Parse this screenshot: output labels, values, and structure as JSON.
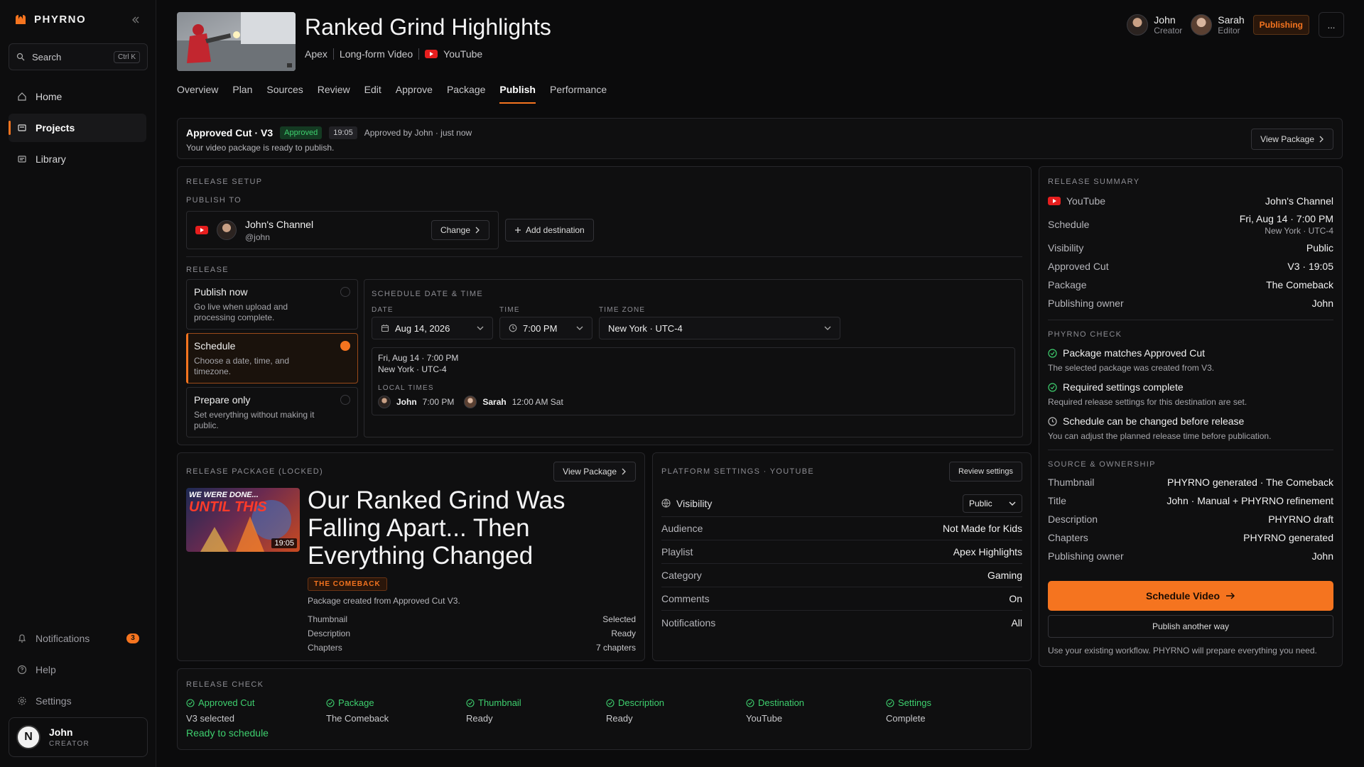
{
  "app": {
    "brand": "PHYRNO",
    "search_placeholder": "Search",
    "search_shortcut": "Ctrl K",
    "nav": [
      {
        "label": "Home",
        "icon": "home-icon"
      },
      {
        "label": "Projects",
        "icon": "folder-icon",
        "active": true
      },
      {
        "label": "Library",
        "icon": "library-icon"
      }
    ],
    "nav_bottom": {
      "notifications": "Notifications",
      "notifications_count": "3",
      "help": "Help",
      "settings": "Settings"
    },
    "user": {
      "initial": "N",
      "name": "John",
      "role": "CREATOR"
    }
  },
  "header": {
    "title": "Ranked Grind Highlights",
    "game": "Apex",
    "format": "Long-form Video",
    "platform": "YouTube",
    "collaborators": [
      {
        "name": "John",
        "role": "Creator"
      },
      {
        "name": "Sarah",
        "role": "Editor"
      }
    ],
    "status": "Publishing",
    "more": "..."
  },
  "tabs": [
    "Overview",
    "Plan",
    "Sources",
    "Review",
    "Edit",
    "Approve",
    "Package",
    "Publish",
    "Performance"
  ],
  "active_tab": "Publish",
  "approved_banner": {
    "title": "Approved Cut · V3",
    "badge": "Approved",
    "duration": "19:05",
    "approved_by": "Approved by John · just now",
    "subtitle": "Your video package is ready to publish.",
    "view_package": "View Package"
  },
  "release_setup": {
    "heading": "RELEASE SETUP",
    "publish_to": "PUBLISH TO",
    "channel_name": "John's Channel",
    "channel_handle": "@john",
    "change": "Change",
    "add_destination": "Add destination",
    "release_label": "RELEASE",
    "options": [
      {
        "title": "Publish now",
        "desc": "Go live when upload and processing complete."
      },
      {
        "title": "Schedule",
        "desc": "Choose a date, time, and timezone.",
        "selected": true
      },
      {
        "title": "Prepare only",
        "desc": "Set everything without making it public."
      }
    ],
    "schedule": {
      "heading": "SCHEDULE DATE & TIME",
      "date_label": "DATE",
      "date": "Aug 14, 2026",
      "time_label": "TIME",
      "time": "7:00 PM",
      "tz_label": "TIME ZONE",
      "tz": "New York · UTC-4",
      "summary_line1": "Fri, Aug 14 · 7:00 PM",
      "summary_line2": "New York · UTC-4",
      "local_times_label": "LOCAL TIMES",
      "local_times": [
        {
          "name": "John",
          "time": "7:00 PM"
        },
        {
          "name": "Sarah",
          "time": "12:00 AM Sat"
        }
      ]
    }
  },
  "release_summary": {
    "heading": "RELEASE SUMMARY",
    "platform": "YouTube",
    "channel": "John's Channel",
    "rows": [
      {
        "k": "Schedule",
        "v": "Fri, Aug 14 · 7:00 PM",
        "sub": "New York · UTC-4"
      },
      {
        "k": "Visibility",
        "v": "Public"
      },
      {
        "k": "Approved Cut",
        "v": "V3 · 19:05"
      },
      {
        "k": "Package",
        "v": "The Comeback"
      },
      {
        "k": "Publishing owner",
        "v": "John"
      }
    ],
    "check_heading": "PHYRNO CHECK",
    "checks": [
      {
        "title": "Package matches Approved Cut",
        "desc": "The selected package was created from V3."
      },
      {
        "title": "Required settings complete",
        "desc": "Required release settings for this destination are set."
      },
      {
        "title": "Schedule can be changed before release",
        "desc": "You can adjust the planned release time before publication."
      }
    ],
    "source_heading": "SOURCE & OWNERSHIP",
    "source_rows": [
      {
        "k": "Thumbnail",
        "v": "PHYRNO generated · The Comeback"
      },
      {
        "k": "Title",
        "v": "John · Manual + PHYRNO refinement"
      },
      {
        "k": "Description",
        "v": "PHYRNO draft"
      },
      {
        "k": "Chapters",
        "v": "PHYRNO generated"
      },
      {
        "k": "Publishing owner",
        "v": "John"
      }
    ],
    "primary_cta": "Schedule Video",
    "secondary_cta": "Publish another way",
    "footnote": "Use your existing workflow. PHYRNO will prepare everything you need."
  },
  "release_package": {
    "heading": "RELEASE PACKAGE (LOCKED)",
    "view_package": "View Package",
    "thumb_text_1": "WE WERE DONE...",
    "thumb_text_2": "UNTIL THIS",
    "thumb_duration": "19:05",
    "title": "Our Ranked Grind Was Falling Apart... Then Everything Changed",
    "tag": "THE COMEBACK",
    "created_from": "Package created from Approved Cut V3.",
    "rows": [
      {
        "k": "Thumbnail",
        "v": "Selected"
      },
      {
        "k": "Description",
        "v": "Ready"
      },
      {
        "k": "Chapters",
        "v": "7 chapters"
      }
    ]
  },
  "platform_settings": {
    "heading": "PLATFORM SETTINGS · YOUTUBE",
    "review": "Review settings",
    "visibility_label": "Visibility",
    "visibility_value": "Public",
    "rows": [
      {
        "k": "Audience",
        "v": "Not Made for Kids"
      },
      {
        "k": "Playlist",
        "v": "Apex Highlights"
      },
      {
        "k": "Category",
        "v": "Gaming"
      },
      {
        "k": "Comments",
        "v": "On"
      },
      {
        "k": "Notifications",
        "v": "All"
      }
    ]
  },
  "release_check": {
    "heading": "RELEASE CHECK",
    "items": [
      {
        "t": "Approved Cut",
        "s": "V3 selected"
      },
      {
        "t": "Package",
        "s": "The Comeback"
      },
      {
        "t": "Thumbnail",
        "s": "Ready"
      },
      {
        "t": "Description",
        "s": "Ready"
      },
      {
        "t": "Destination",
        "s": "YouTube"
      },
      {
        "t": "Settings",
        "s": "Complete"
      }
    ],
    "status": "Ready to schedule"
  },
  "colors": {
    "accent": "#f5741f",
    "success": "#3ecf6e",
    "bg": "#0b0b0c",
    "youtube": "#e61e1e"
  }
}
